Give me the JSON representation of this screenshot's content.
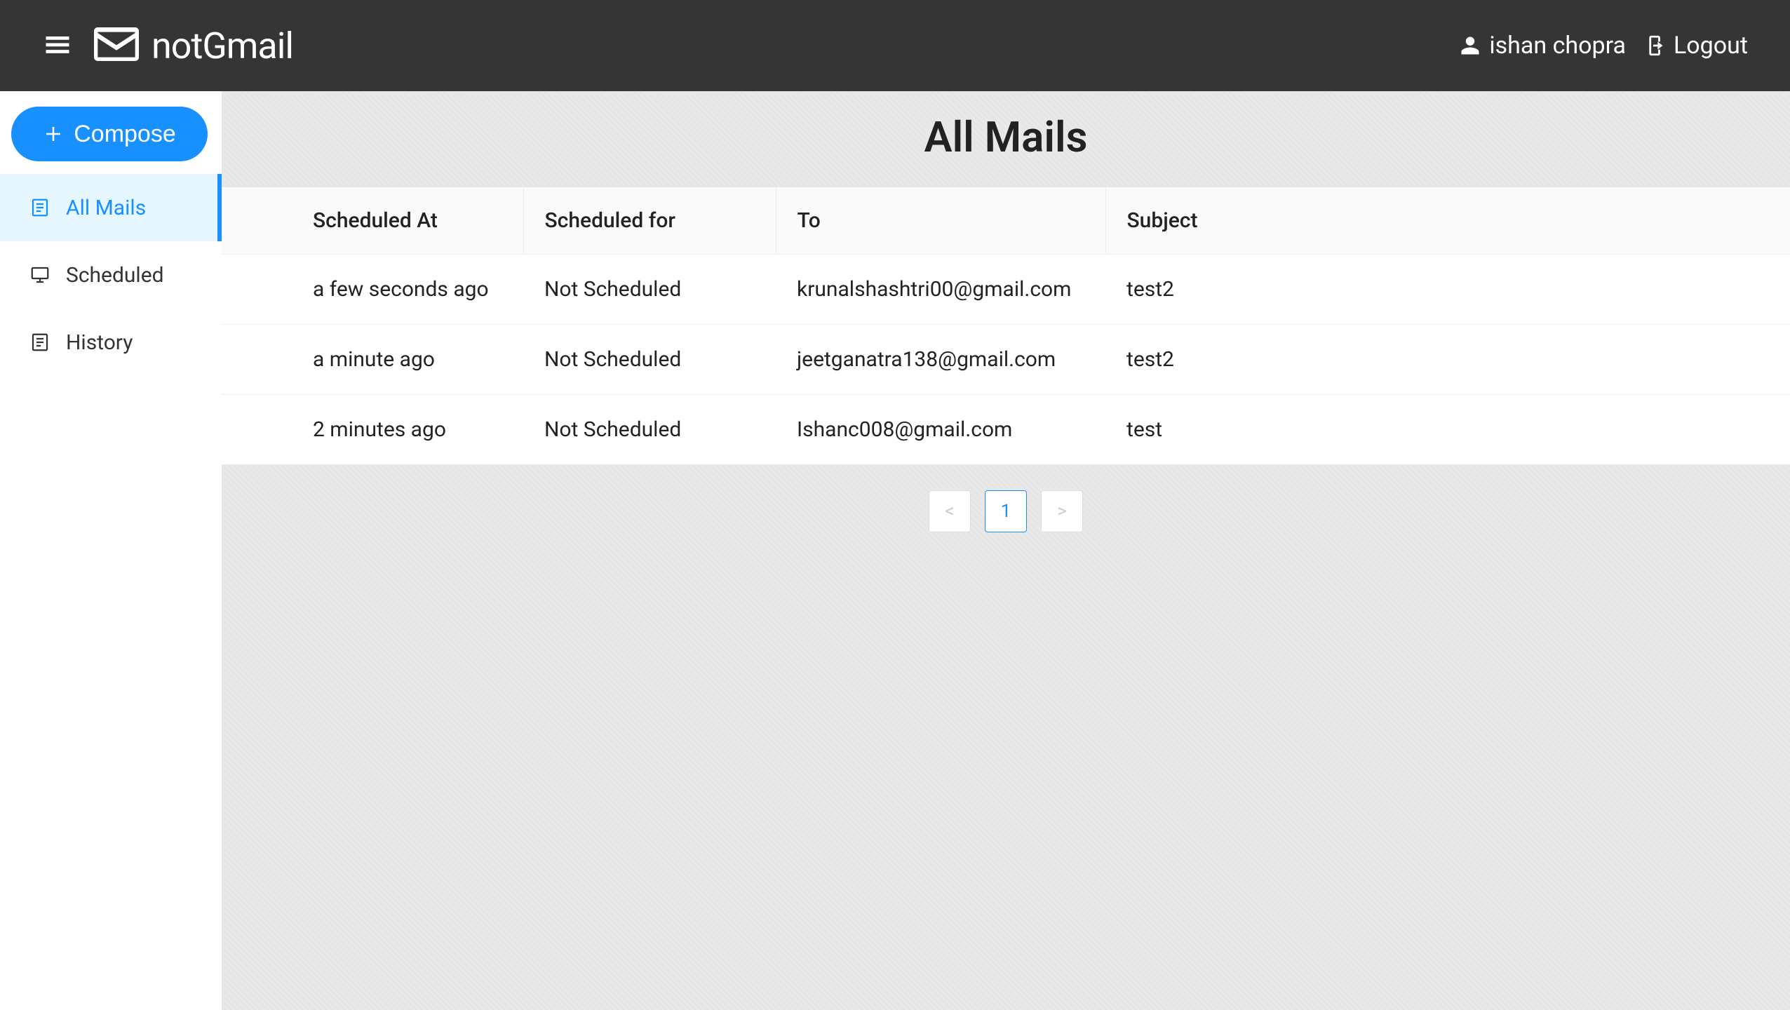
{
  "header": {
    "app_name": "notGmail",
    "username": "ishan chopra",
    "logout_label": "Logout"
  },
  "sidebar": {
    "compose_label": "Compose",
    "items": [
      {
        "label": "All Mails",
        "active": true,
        "icon": "list-doc"
      },
      {
        "label": "Scheduled",
        "active": false,
        "icon": "monitor"
      },
      {
        "label": "History",
        "active": false,
        "icon": "list-doc"
      }
    ]
  },
  "main": {
    "title": "All Mails",
    "columns": {
      "scheduled_at": "Scheduled At",
      "scheduled_for": "Scheduled for",
      "to": "To",
      "subject": "Subject"
    },
    "rows": [
      {
        "scheduled_at": "a few seconds ago",
        "scheduled_for": "Not Scheduled",
        "to": "krunalshashtri00@gmail.com",
        "subject": "test2"
      },
      {
        "scheduled_at": "a minute ago",
        "scheduled_for": "Not Scheduled",
        "to": "jeetganatra138@gmail.com",
        "subject": "test2"
      },
      {
        "scheduled_at": "2 minutes ago",
        "scheduled_for": "Not Scheduled",
        "to": "Ishanc008@gmail.com",
        "subject": "test"
      }
    ]
  },
  "pagination": {
    "prev": "<",
    "next": ">",
    "pages": [
      "1"
    ],
    "active": "1"
  },
  "colors": {
    "accent": "#1890ff",
    "header_bg": "#353535",
    "active_bg": "#e6f7ff"
  }
}
